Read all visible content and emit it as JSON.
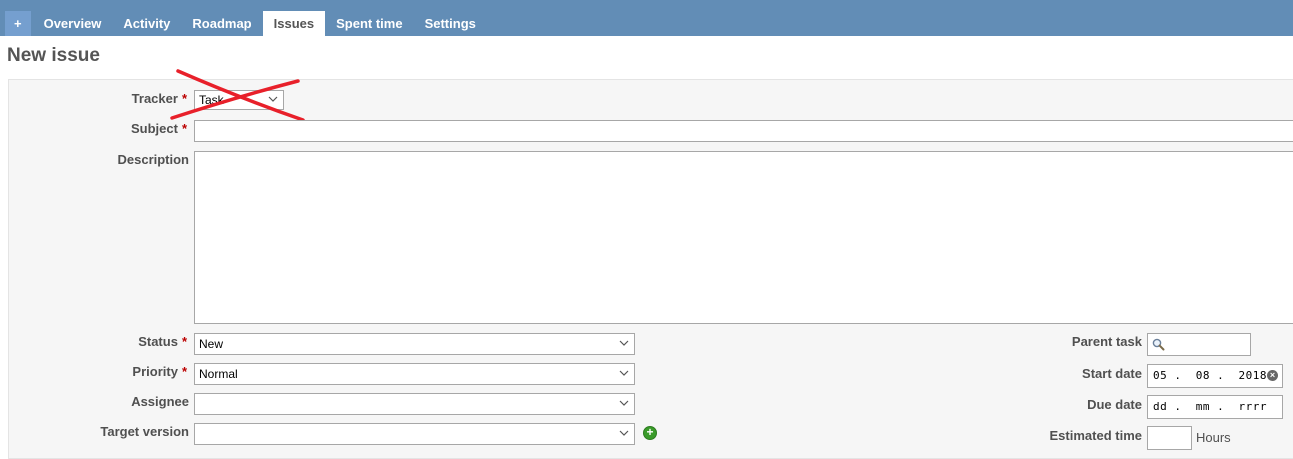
{
  "tabs": [
    {
      "label": "+"
    },
    {
      "label": "Overview"
    },
    {
      "label": "Activity"
    },
    {
      "label": "Roadmap"
    },
    {
      "label": "Issues",
      "selected": true
    },
    {
      "label": "Spent time"
    },
    {
      "label": "Settings"
    }
  ],
  "page": {
    "title": "New issue"
  },
  "form": {
    "required_mark": "*",
    "tracker": {
      "label": "Tracker",
      "value": "Task"
    },
    "subject": {
      "label": "Subject",
      "value": ""
    },
    "description": {
      "label": "Description",
      "value": ""
    },
    "status": {
      "label": "Status",
      "value": "New"
    },
    "priority": {
      "label": "Priority",
      "value": "Normal"
    },
    "assignee": {
      "label": "Assignee",
      "value": ""
    },
    "target_version": {
      "label": "Target version",
      "value": ""
    },
    "parent_task": {
      "label": "Parent task",
      "value": ""
    },
    "start_date": {
      "label": "Start date",
      "value": "05 .  08 .  2018"
    },
    "due_date": {
      "label": "Due date",
      "value": "dd .  mm .  rrrr"
    },
    "estimated_time": {
      "label": "Estimated time",
      "value": "",
      "unit": "Hours"
    }
  },
  "colors": {
    "tabbar": "#628db6",
    "required": "#bb0000",
    "annotation_cross": "#e8202a"
  }
}
